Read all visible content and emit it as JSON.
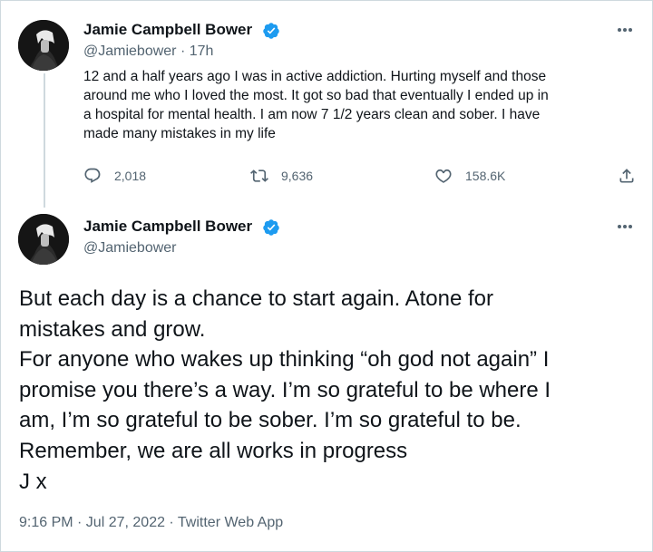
{
  "tweet1": {
    "display_name": "Jamie Campbell Bower",
    "handle": "@Jamiebower",
    "separator": "·",
    "time_ago": "17h",
    "text_lines": [
      "12 and a half years ago I was in active addiction. Hurting myself and those",
      "around me who I loved the most. It got so bad that eventually I ended up in",
      "a hospital for mental health. I am now 7 1/2 years clean and sober. I have",
      "made many mistakes in my life"
    ],
    "reply_count": "2,018",
    "retweet_count": "9,636",
    "like_count": "158.6K"
  },
  "tweet2": {
    "display_name": "Jamie Campbell Bower",
    "handle": "@Jamiebower",
    "text_lines": [
      "But each day is a chance to start again. Atone for",
      "mistakes and grow.",
      "For anyone who wakes up thinking “oh god not again” I",
      "promise you there’s a way. I’m so grateful to be where I",
      "am, I’m so grateful to be sober. I’m so grateful to be.",
      "Remember, we are all works in progress",
      "J x"
    ],
    "timestamp": "9:16 PM · Jul 27, 2022 · Twitter Web App"
  },
  "colors": {
    "verified_blue": "#1d9bf0",
    "secondary_text": "#536471",
    "primary_text": "#0f1419",
    "border": "#cfd9de"
  },
  "icons": {
    "reply": "reply-icon",
    "retweet": "retweet-icon",
    "like": "heart-icon",
    "share": "share-icon",
    "more": "more-icon",
    "verified": "verified-badge-icon"
  }
}
